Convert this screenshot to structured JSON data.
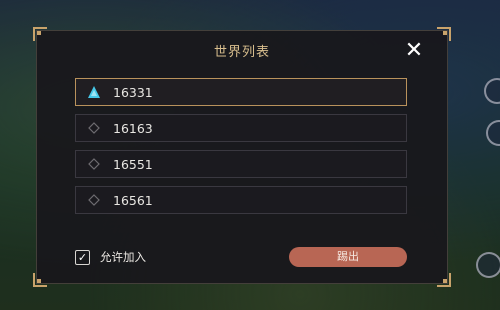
{
  "dialog": {
    "title": "世界列表",
    "close_icon": "close-icon"
  },
  "worlds": [
    {
      "id": "16331",
      "selected": true,
      "icon": "active-world-triangle-icon"
    },
    {
      "id": "16163",
      "selected": false,
      "icon": "diamond-icon"
    },
    {
      "id": "16551",
      "selected": false,
      "icon": "diamond-icon"
    },
    {
      "id": "16561",
      "selected": false,
      "icon": "diamond-icon"
    }
  ],
  "footer": {
    "allow_join_label": "允许加入",
    "allow_join_checked": true,
    "kick_label": "踢出"
  },
  "colors": {
    "accent_gold": "#c9a36b",
    "title_gold": "#d9bf8e",
    "active_icon": "#46c8e8",
    "kick_button": "#b86654"
  }
}
